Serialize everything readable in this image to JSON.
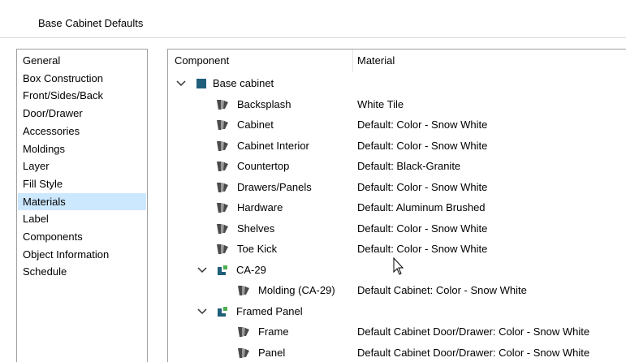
{
  "window": {
    "title": "Base Cabinet Defaults"
  },
  "sidebar": {
    "items": [
      {
        "label": "General",
        "selected": false
      },
      {
        "label": "Box Construction",
        "selected": false
      },
      {
        "label": "Front/Sides/Back",
        "selected": false
      },
      {
        "label": "Door/Drawer",
        "selected": false
      },
      {
        "label": "Accessories",
        "selected": false
      },
      {
        "label": "Moldings",
        "selected": false
      },
      {
        "label": "Layer",
        "selected": false
      },
      {
        "label": "Fill Style",
        "selected": false
      },
      {
        "label": "Materials",
        "selected": true
      },
      {
        "label": "Label",
        "selected": false
      },
      {
        "label": "Components",
        "selected": false
      },
      {
        "label": "Object Information",
        "selected": false
      },
      {
        "label": "Schedule",
        "selected": false
      }
    ]
  },
  "table": {
    "headers": {
      "component": "Component",
      "material": "Material"
    },
    "rows": [
      {
        "component": "Base cabinet",
        "material": "",
        "icon": "cabinet-group-icon",
        "expanded": true
      },
      {
        "component": "Backsplash",
        "material": "White Tile",
        "icon": "material-swatch-icon"
      },
      {
        "component": "Cabinet",
        "material": "Default: Color - Snow White",
        "icon": "material-swatch-icon"
      },
      {
        "component": "Cabinet Interior",
        "material": "Default: Color - Snow White",
        "icon": "material-swatch-icon"
      },
      {
        "component": "Countertop",
        "material": "Default: Black-Granite",
        "icon": "material-swatch-icon"
      },
      {
        "component": "Drawers/Panels",
        "material": "Default: Color - Snow White",
        "icon": "material-swatch-icon"
      },
      {
        "component": "Hardware",
        "material": "Default: Aluminum Brushed",
        "icon": "material-swatch-icon"
      },
      {
        "component": "Shelves",
        "material": "Default: Color - Snow White",
        "icon": "material-swatch-icon"
      },
      {
        "component": "Toe Kick",
        "material": "Default: Color - Snow White",
        "icon": "material-swatch-icon"
      },
      {
        "component": "CA-29",
        "material": "",
        "icon": "molding-group-icon",
        "expanded": true
      },
      {
        "component": "Molding (CA-29)",
        "material": "Default Cabinet: Color - Snow White",
        "icon": "material-swatch-icon"
      },
      {
        "component": "Framed Panel",
        "material": "",
        "icon": "molding-group-icon",
        "expanded": true
      },
      {
        "component": "Frame",
        "material": "Default Cabinet Door/Drawer: Color - Snow White",
        "icon": "material-swatch-icon"
      },
      {
        "component": "Panel",
        "material": "Default Cabinet Door/Drawer: Color - Snow White",
        "icon": "material-swatch-icon"
      }
    ]
  },
  "colors": {
    "selection": "#cce8ff",
    "cabinet_icon": "#1f5f7a",
    "molding_icon_dark": "#1f5f7a",
    "molding_icon_green": "#4caf50",
    "swatch_dark": "#4a4a4a",
    "swatch_light": "#9a9a9a"
  }
}
